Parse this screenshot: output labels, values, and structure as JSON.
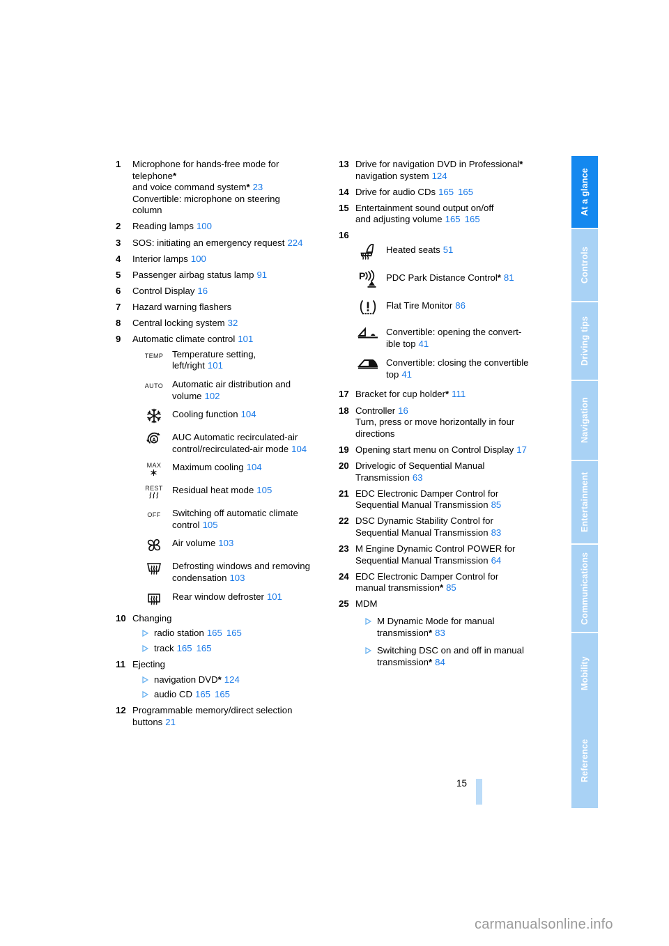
{
  "page": {
    "number": "15",
    "watermark": "carmanualsonline.info"
  },
  "tabs": [
    {
      "label": "At a glance",
      "active": true
    },
    {
      "label": "Controls",
      "active": false
    },
    {
      "label": "Driving tips",
      "active": false
    },
    {
      "label": "Navigation",
      "active": false
    },
    {
      "label": "Entertainment",
      "active": false
    },
    {
      "label": "Communications",
      "active": false
    },
    {
      "label": "Mobility",
      "active": false
    },
    {
      "label": "Reference",
      "active": false
    }
  ],
  "colors": {
    "accent_blue": "#1a7ae8",
    "tab_active": "#1488ef",
    "tab_inactive": "#a9d2f5",
    "page_marker": "#bcdcf8",
    "watermark": "#9a9a9a"
  },
  "left_column": {
    "item1": {
      "num": "1",
      "line1": "Microphone for hands-free mode for",
      "line2": "telephone",
      "line3": "and voice command system",
      "ref3": "23",
      "line4": "Convertible: microphone on steering",
      "line5": "column"
    },
    "item2": {
      "num": "2",
      "text": "Reading lamps",
      "ref": "100"
    },
    "item3": {
      "num": "3",
      "text": "SOS: initiating an emergency request",
      "ref": "224"
    },
    "item4": {
      "num": "4",
      "text": "Interior lamps",
      "ref": "100"
    },
    "item5": {
      "num": "5",
      "text": "Passenger airbag status lamp",
      "ref": "91"
    },
    "item6": {
      "num": "6",
      "text": "Control Display",
      "ref": "16"
    },
    "item7": {
      "num": "7",
      "text": "Hazard warning flashers"
    },
    "item8": {
      "num": "8",
      "text": "Central locking system",
      "ref": "32"
    },
    "item9": {
      "num": "9",
      "text": "Automatic climate control",
      "ref": "101"
    },
    "climate_icons": [
      {
        "icon": "temp-label-icon",
        "icon_label": "TEMP",
        "line1": "Temperature setting,",
        "line2": "left/right",
        "ref": "101"
      },
      {
        "icon": "auto-label-icon",
        "icon_label": "AUTO",
        "line1": "Automatic air distribution and",
        "line2": "volume",
        "ref": "102"
      },
      {
        "icon": "snowflake-icon",
        "line1": "Cooling function",
        "ref": "104"
      },
      {
        "icon": "auc-recirculation-icon",
        "line1": "AUC Automatic recirculated-air",
        "line2": "control/recirculated-air mode",
        "ref": "104"
      },
      {
        "icon": "max-cooling-icon",
        "icon_label": "MAX",
        "line1": "Maximum cooling",
        "ref": "104"
      },
      {
        "icon": "residual-heat-icon",
        "icon_label": "REST",
        "line1": "Residual heat mode",
        "ref": "105"
      },
      {
        "icon": "off-label-icon",
        "icon_label": "OFF",
        "line1": "Switching off automatic climate",
        "line2": "control",
        "ref": "105"
      },
      {
        "icon": "fan-icon",
        "line1": "Air volume",
        "ref": "103"
      },
      {
        "icon": "windshield-defrost-icon",
        "line1": "Defrosting windows and removing",
        "line2": "condensation",
        "ref": "103"
      },
      {
        "icon": "rear-window-defrost-icon",
        "line1": "Rear window defroster",
        "ref": "101"
      }
    ],
    "item10": {
      "num": "10",
      "text": "Changing",
      "subs": [
        {
          "text": "radio station",
          "ref1": "165",
          "ref2": "165"
        },
        {
          "text": "track",
          "ref1": "165",
          "ref2": "165"
        }
      ]
    },
    "item11": {
      "num": "11",
      "text": "Ejecting",
      "subs": [
        {
          "text": "navigation DVD",
          "asterisk": true,
          "ref1": "124"
        },
        {
          "text": "audio CD",
          "ref1": "165",
          "ref2": "165"
        }
      ]
    },
    "item12": {
      "num": "12",
      "line1": "Programmable memory/direct selection",
      "line2": "buttons",
      "ref": "21"
    }
  },
  "right_column": {
    "item13": {
      "num": "13",
      "line1": "Drive for navigation DVD in Professional",
      "line2": "navigation system",
      "ref": "124"
    },
    "item14": {
      "num": "14",
      "text": "Drive for audio CDs",
      "ref1": "165",
      "ref2": "165"
    },
    "item15": {
      "num": "15",
      "line1": "Entertainment sound output on/off",
      "line2": "and adjusting volume",
      "ref1": "165",
      "ref2": "165"
    },
    "item16": {
      "num": "16",
      "icons": [
        {
          "icon": "heated-seat-icon",
          "line1": "Heated seats",
          "ref": "51"
        },
        {
          "icon": "pdc-park-distance-icon",
          "line1": "PDC Park Distance Control",
          "asterisk": true,
          "ref": "81"
        },
        {
          "icon": "flat-tire-monitor-icon",
          "line1": "Flat Tire Monitor",
          "ref": "86"
        },
        {
          "icon": "convertible-top-open-icon",
          "line1": "Convertible: opening the convert-",
          "line2": "ible top",
          "ref": "41"
        },
        {
          "icon": "convertible-top-close-icon",
          "line1": "Convertible: closing the convertible",
          "line2": "top",
          "ref": "41"
        }
      ]
    },
    "item17": {
      "num": "17",
      "text": "Bracket for cup holder",
      "asterisk": true,
      "ref": "111"
    },
    "item18": {
      "num": "18",
      "line1": "Controller",
      "ref": "16",
      "line2": "Turn, press or move horizontally in four",
      "line3": "directions"
    },
    "item19": {
      "num": "19",
      "text": "Opening start menu on Control Display",
      "ref": "17"
    },
    "item20": {
      "num": "20",
      "line1": "Drivelogic of Sequential Manual",
      "line2": "Transmission",
      "ref": "63"
    },
    "item21": {
      "num": "21",
      "line1": "EDC Electronic Damper Control for",
      "line2": "Sequential Manual Transmission",
      "ref": "85"
    },
    "item22": {
      "num": "22",
      "line1": "DSC Dynamic Stability Control for",
      "line2": "Sequential Manual Transmission",
      "ref": "83"
    },
    "item23": {
      "num": "23",
      "line1": "M Engine Dynamic Control POWER for",
      "line2": "Sequential Manual Transmission",
      "ref": "64"
    },
    "item24": {
      "num": "24",
      "line1": "EDC Electronic Damper Control for",
      "line2": "manual transmission",
      "ref": "85"
    },
    "item25": {
      "num": "25",
      "text": "MDM",
      "subs": [
        {
          "line1": "M Dynamic Mode for manual",
          "line2": "transmission",
          "asterisk": true,
          "ref": "83"
        },
        {
          "line1": "Switching DSC on and off in manual",
          "line2": "transmission",
          "asterisk": true,
          "ref": "84"
        }
      ]
    }
  }
}
